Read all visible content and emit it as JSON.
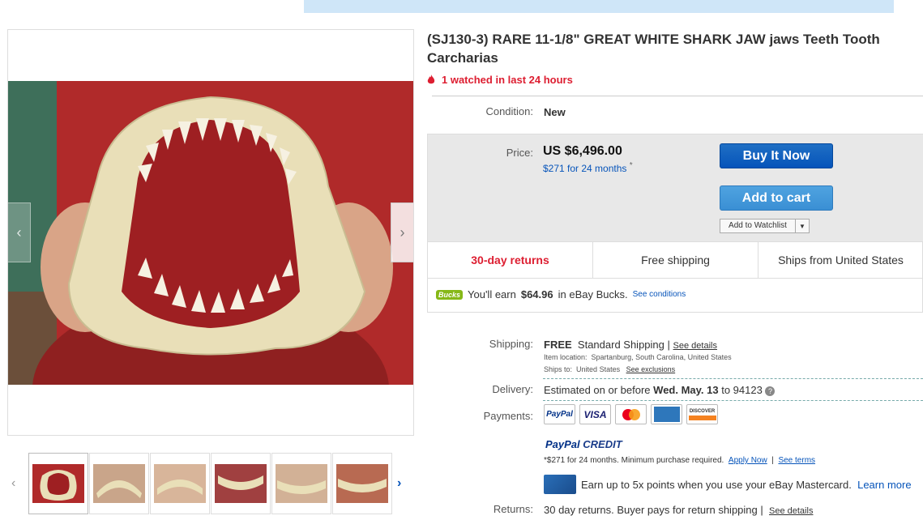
{
  "listing": {
    "title": "(SJ130-3) RARE 11-1/8\" GREAT WHITE SHARK JAW jaws Teeth Tooth Carcharias",
    "watched": "1 watched in last 24 hours"
  },
  "condition": {
    "label": "Condition:",
    "value": "New"
  },
  "price": {
    "label": "Price:",
    "value": "US $6,496.00",
    "monthly": "$271 for 24 months",
    "monthly_mark": "*"
  },
  "buttons": {
    "buy_now": "Buy It Now",
    "add_to_cart": "Add to cart",
    "watchlist": "Add to Watchlist"
  },
  "features": [
    "30-day returns",
    "Free shipping",
    "Ships from United States"
  ],
  "bucks": {
    "logo": "Bucks",
    "prefix": "You'll earn",
    "amount": "$64.96",
    "suffix": "in eBay Bucks.",
    "link": "See conditions"
  },
  "shipping": {
    "label": "Shipping:",
    "free": "FREE",
    "method": "Standard Shipping",
    "sep": "|",
    "details_link": "See details",
    "location_label": "Item location:",
    "location": "Spartanburg, South Carolina, United States",
    "ships_to_label": "Ships to:",
    "ships_to": "United States",
    "exclusions_link": "See exclusions"
  },
  "delivery": {
    "label": "Delivery:",
    "prefix": "Estimated on or before",
    "date": "Wed. May. 13",
    "suffix": "to 94123"
  },
  "payments": {
    "label": "Payments:",
    "methods": [
      "PayPal",
      "VISA",
      "Mastercard",
      "American Express",
      "DISCOVER"
    ]
  },
  "paypal_credit": {
    "logo_a": "PayPal",
    "logo_b": "CREDIT",
    "text": "*$271 for 24 months. Minimum purchase required.",
    "apply": "Apply Now",
    "sep": "|",
    "terms": "See terms"
  },
  "mastercard_promo": {
    "text": "Earn up to 5x points when you use your eBay Mastercard.",
    "link": "Learn more"
  },
  "returns": {
    "label": "Returns:",
    "text": "30 day returns. Buyer pays for return shipping",
    "sep": "|",
    "link": "See details"
  },
  "colors": {
    "accent_blue": "#0654ba",
    "alert_red": "#dd1e31",
    "bucks_green": "#86b817"
  }
}
